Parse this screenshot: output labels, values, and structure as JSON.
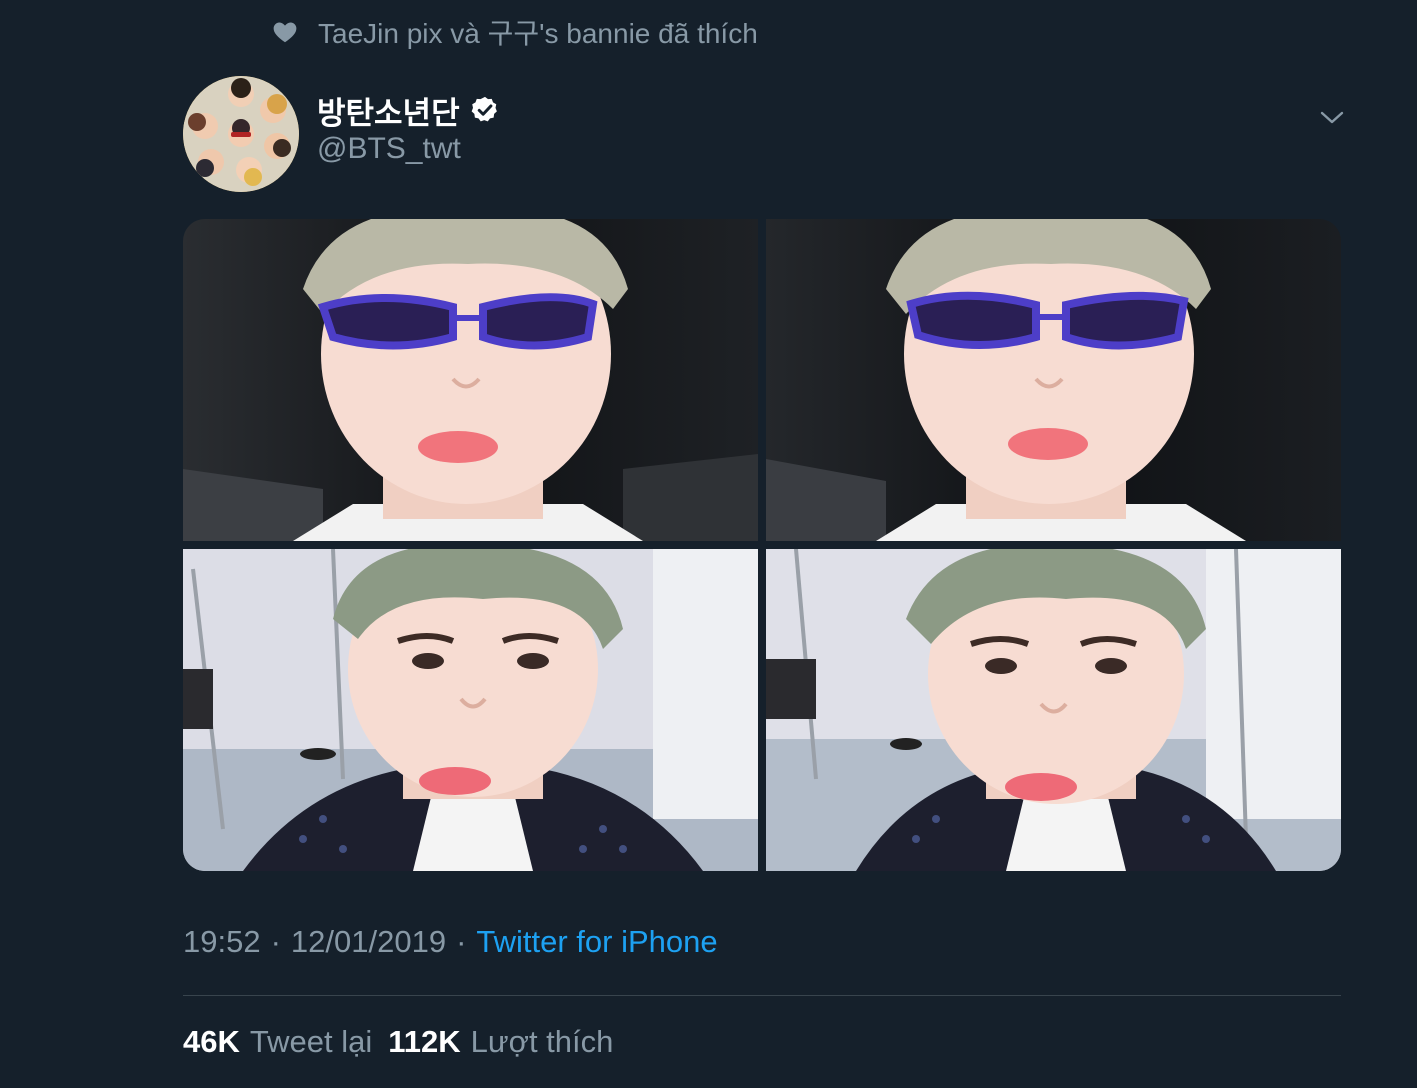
{
  "social_context": {
    "icon": "heart-icon",
    "text": "TaeJin pix và 구구's bannie đã thích"
  },
  "tweet": {
    "author": {
      "display_name": "방탄소년단",
      "handle": "@BTS_twt",
      "verified": true
    },
    "media": [
      {
        "description": "photo-1"
      },
      {
        "description": "photo-2"
      },
      {
        "description": "photo-3"
      },
      {
        "description": "photo-4"
      }
    ],
    "time": "19:52",
    "separator": "·",
    "date": "12/01/2019",
    "source": "Twitter for iPhone",
    "stats": {
      "retweets_count": "46K",
      "retweets_label": "Tweet lại",
      "likes_count": "112K",
      "likes_label": "Lượt thích"
    }
  },
  "colors": {
    "background": "#15202b",
    "secondary_text": "#8899a6",
    "link": "#1da1f2",
    "divider": "#38444d"
  }
}
